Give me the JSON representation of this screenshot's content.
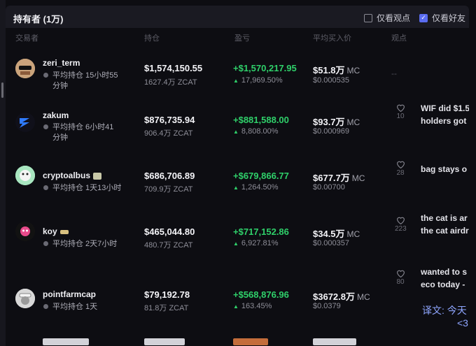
{
  "header": {
    "title": "持有者 (1万)",
    "filter_views": {
      "label": "仅看观点",
      "checked": false
    },
    "filter_friends": {
      "label": "仅看好友",
      "checked": true
    }
  },
  "columns": {
    "trader": "交易者",
    "holding": "持仓",
    "pnl": "盈亏",
    "avg_price": "平均买入价",
    "views": "观点"
  },
  "rows": [
    {
      "name": "zeri_term",
      "hold_line1": "平均持仓 15小时55",
      "hold_line2": "分钟",
      "value": "$1,574,150.55",
      "amount": "1627.4万 ZCAT",
      "pnl": "+$1,570,217.95",
      "pct": "17,969.50%",
      "mc": "$51.8万",
      "mc_unit": "MC",
      "price": "$0.000535",
      "dash": "--"
    },
    {
      "name": "zakum",
      "hold_line1": "平均持仓 6小时41",
      "hold_line2": "分钟",
      "value": "$876,735.94",
      "amount": "906.4万 ZCAT",
      "pnl": "+$881,588.00",
      "pct": "8,808.00%",
      "mc": "$93.7万",
      "mc_unit": "MC",
      "price": "$0.000969",
      "likes": "10",
      "note1": "WIF did $1.5",
      "note2": "holders got"
    },
    {
      "name": "cryptoalbus",
      "hold_line1": "平均持仓 1天13小时",
      "value": "$686,706.89",
      "amount": "709.9万 ZCAT",
      "pnl": "+$679,866.77",
      "pct": "1,264.50%",
      "mc": "$677.7万",
      "mc_unit": "MC",
      "price": "$0.00700",
      "likes": "28",
      "note1": "bag stays o"
    },
    {
      "name": "koy",
      "hold_line1": "平均持仓 2天7小时",
      "value": "$465,044.80",
      "amount": "480.7万 ZCAT",
      "pnl": "+$717,152.86",
      "pct": "6,927.81%",
      "mc": "$34.5万",
      "mc_unit": "MC",
      "price": "$0.000357",
      "likes": "223",
      "note1": "the cat is ar",
      "note2": "the cat airdr"
    },
    {
      "name": "pointfarmcap",
      "hold_line1": "平均持仓 1天",
      "value": "$79,192.78",
      "amount": "81.8万 ZCAT",
      "pnl": "+$568,876.96",
      "pct": "163.45%",
      "mc": "$3672.8万",
      "mc_unit": "MC",
      "price": "$0.0379",
      "likes": "80",
      "note1": "wanted to s",
      "note2": "eco today -",
      "translation": "译文: 今天",
      "translation2": "<3"
    }
  ],
  "colors": {
    "background": "#0d0d12",
    "header": "#1a1a22",
    "profit": "#2fd06a",
    "accent": "#5a6cf0",
    "translation": "#8fa6ff"
  },
  "icons": [
    "heart-icon",
    "clock-icon",
    "checkbox-icon",
    "caret-up-icon"
  ]
}
